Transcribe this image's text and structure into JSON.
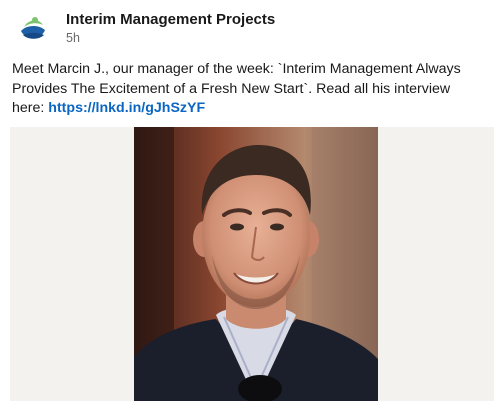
{
  "post": {
    "author": "Interim Management Projects",
    "time": "5h",
    "text": "Meet Marcin J., our manager of the week: `Interim Management Always Provides The Excitement of a Fresh New Start`. Read all his interview here: ",
    "link": "https://lnkd.in/gJhSzYF"
  },
  "icons": {
    "logo": "company-logo-icon"
  },
  "colors": {
    "link": "#0a66c2",
    "media_background": "#f3f2ef",
    "logo_blue": "#1f5fa8",
    "logo_green": "#7cc36e"
  }
}
